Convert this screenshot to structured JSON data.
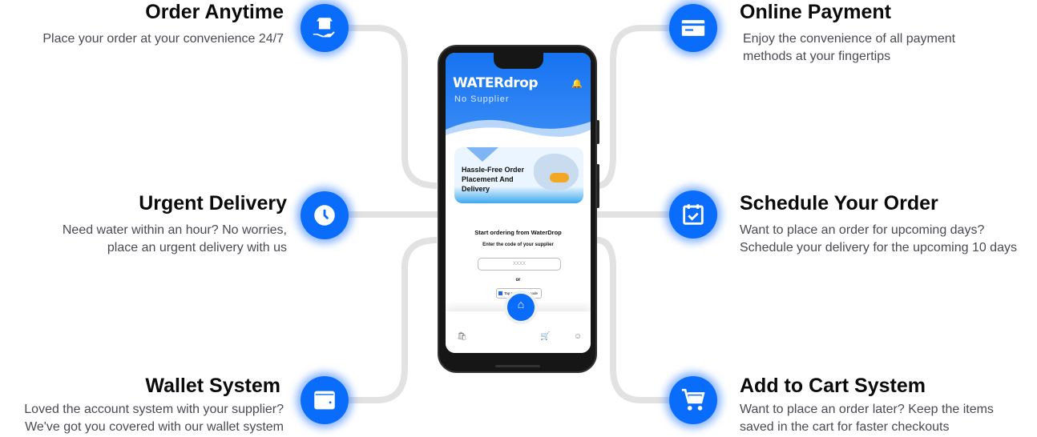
{
  "features": [
    {
      "title": "Order Anytime",
      "desc": "Place your order at your convenience 24/7"
    },
    {
      "title": "Urgent Delivery",
      "desc": "Need water within an hour? No worries, place an urgent delivery with us"
    },
    {
      "title": "Wallet System",
      "desc": "Loved the account system with your supplier? We've got you covered with our wallet system"
    },
    {
      "title": "Online Payment",
      "desc": "Enjoy the convenience of all payment methods at your fingertips"
    },
    {
      "title": "Schedule Your Order",
      "desc": "Want to place an order for upcoming days? Schedule your delivery for the upcoming 10 days"
    },
    {
      "title": "Add to Cart System",
      "desc": "Want to place an order later? Keep the items saved in the cart for faster checkouts"
    }
  ],
  "app": {
    "brand": "WATERdrop",
    "subtitle": "No Supplier",
    "banner": "Hassle-Free Order Placement And Delivery",
    "heading": "Start ordering from WaterDrop",
    "prompt": "Enter the code of your supplier",
    "code_placeholder": "XXXX",
    "or": "or",
    "qr_label": "Tap to scan QR code"
  },
  "colors": {
    "accent": "#0a6cfa",
    "line": "#e0e0e0"
  }
}
